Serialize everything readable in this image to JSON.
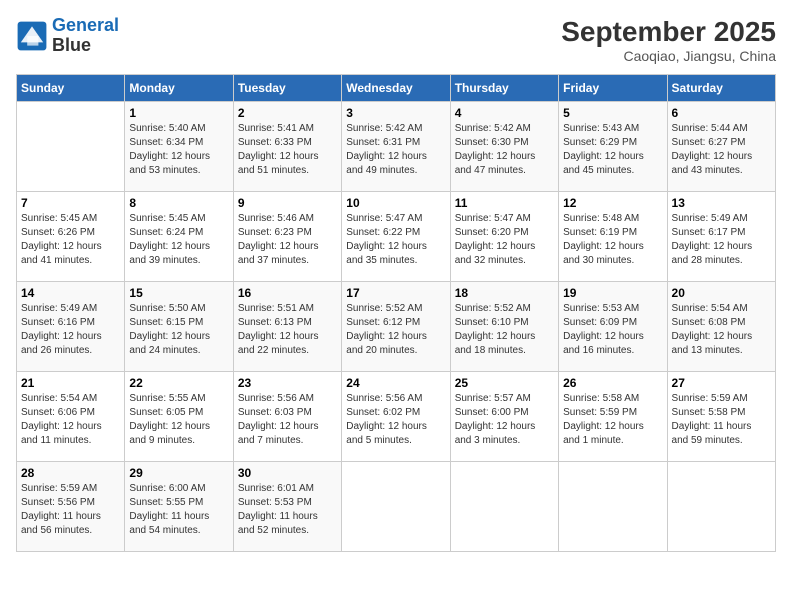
{
  "header": {
    "logo_line1": "General",
    "logo_line2": "Blue",
    "month_year": "September 2025",
    "location": "Caoqiao, Jiangsu, China"
  },
  "days_of_week": [
    "Sunday",
    "Monday",
    "Tuesday",
    "Wednesday",
    "Thursday",
    "Friday",
    "Saturday"
  ],
  "weeks": [
    [
      {
        "day": "",
        "content": ""
      },
      {
        "day": "1",
        "content": "Sunrise: 5:40 AM\nSunset: 6:34 PM\nDaylight: 12 hours\nand 53 minutes."
      },
      {
        "day": "2",
        "content": "Sunrise: 5:41 AM\nSunset: 6:33 PM\nDaylight: 12 hours\nand 51 minutes."
      },
      {
        "day": "3",
        "content": "Sunrise: 5:42 AM\nSunset: 6:31 PM\nDaylight: 12 hours\nand 49 minutes."
      },
      {
        "day": "4",
        "content": "Sunrise: 5:42 AM\nSunset: 6:30 PM\nDaylight: 12 hours\nand 47 minutes."
      },
      {
        "day": "5",
        "content": "Sunrise: 5:43 AM\nSunset: 6:29 PM\nDaylight: 12 hours\nand 45 minutes."
      },
      {
        "day": "6",
        "content": "Sunrise: 5:44 AM\nSunset: 6:27 PM\nDaylight: 12 hours\nand 43 minutes."
      }
    ],
    [
      {
        "day": "7",
        "content": "Sunrise: 5:45 AM\nSunset: 6:26 PM\nDaylight: 12 hours\nand 41 minutes."
      },
      {
        "day": "8",
        "content": "Sunrise: 5:45 AM\nSunset: 6:24 PM\nDaylight: 12 hours\nand 39 minutes."
      },
      {
        "day": "9",
        "content": "Sunrise: 5:46 AM\nSunset: 6:23 PM\nDaylight: 12 hours\nand 37 minutes."
      },
      {
        "day": "10",
        "content": "Sunrise: 5:47 AM\nSunset: 6:22 PM\nDaylight: 12 hours\nand 35 minutes."
      },
      {
        "day": "11",
        "content": "Sunrise: 5:47 AM\nSunset: 6:20 PM\nDaylight: 12 hours\nand 32 minutes."
      },
      {
        "day": "12",
        "content": "Sunrise: 5:48 AM\nSunset: 6:19 PM\nDaylight: 12 hours\nand 30 minutes."
      },
      {
        "day": "13",
        "content": "Sunrise: 5:49 AM\nSunset: 6:17 PM\nDaylight: 12 hours\nand 28 minutes."
      }
    ],
    [
      {
        "day": "14",
        "content": "Sunrise: 5:49 AM\nSunset: 6:16 PM\nDaylight: 12 hours\nand 26 minutes."
      },
      {
        "day": "15",
        "content": "Sunrise: 5:50 AM\nSunset: 6:15 PM\nDaylight: 12 hours\nand 24 minutes."
      },
      {
        "day": "16",
        "content": "Sunrise: 5:51 AM\nSunset: 6:13 PM\nDaylight: 12 hours\nand 22 minutes."
      },
      {
        "day": "17",
        "content": "Sunrise: 5:52 AM\nSunset: 6:12 PM\nDaylight: 12 hours\nand 20 minutes."
      },
      {
        "day": "18",
        "content": "Sunrise: 5:52 AM\nSunset: 6:10 PM\nDaylight: 12 hours\nand 18 minutes."
      },
      {
        "day": "19",
        "content": "Sunrise: 5:53 AM\nSunset: 6:09 PM\nDaylight: 12 hours\nand 16 minutes."
      },
      {
        "day": "20",
        "content": "Sunrise: 5:54 AM\nSunset: 6:08 PM\nDaylight: 12 hours\nand 13 minutes."
      }
    ],
    [
      {
        "day": "21",
        "content": "Sunrise: 5:54 AM\nSunset: 6:06 PM\nDaylight: 12 hours\nand 11 minutes."
      },
      {
        "day": "22",
        "content": "Sunrise: 5:55 AM\nSunset: 6:05 PM\nDaylight: 12 hours\nand 9 minutes."
      },
      {
        "day": "23",
        "content": "Sunrise: 5:56 AM\nSunset: 6:03 PM\nDaylight: 12 hours\nand 7 minutes."
      },
      {
        "day": "24",
        "content": "Sunrise: 5:56 AM\nSunset: 6:02 PM\nDaylight: 12 hours\nand 5 minutes."
      },
      {
        "day": "25",
        "content": "Sunrise: 5:57 AM\nSunset: 6:00 PM\nDaylight: 12 hours\nand 3 minutes."
      },
      {
        "day": "26",
        "content": "Sunrise: 5:58 AM\nSunset: 5:59 PM\nDaylight: 12 hours\nand 1 minute."
      },
      {
        "day": "27",
        "content": "Sunrise: 5:59 AM\nSunset: 5:58 PM\nDaylight: 11 hours\nand 59 minutes."
      }
    ],
    [
      {
        "day": "28",
        "content": "Sunrise: 5:59 AM\nSunset: 5:56 PM\nDaylight: 11 hours\nand 56 minutes."
      },
      {
        "day": "29",
        "content": "Sunrise: 6:00 AM\nSunset: 5:55 PM\nDaylight: 11 hours\nand 54 minutes."
      },
      {
        "day": "30",
        "content": "Sunrise: 6:01 AM\nSunset: 5:53 PM\nDaylight: 11 hours\nand 52 minutes."
      },
      {
        "day": "",
        "content": ""
      },
      {
        "day": "",
        "content": ""
      },
      {
        "day": "",
        "content": ""
      },
      {
        "day": "",
        "content": ""
      }
    ]
  ]
}
